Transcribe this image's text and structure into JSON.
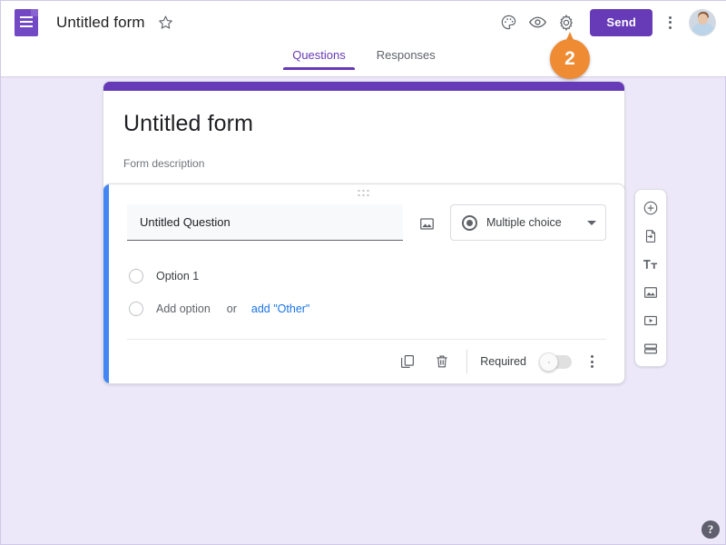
{
  "app": {
    "name": "Google Forms",
    "background_color": "#ece8fa",
    "accent_color": "#673ab7",
    "selected_color": "#4285f4",
    "link_color": "#1a73e8",
    "callout_color": "#ee8b33"
  },
  "topbar": {
    "forms_icon": "forms-document-icon",
    "doc_title": "Untitled form",
    "star_icon": "star-outline-icon",
    "theme_icon": "palette-icon",
    "preview_icon": "eye-icon",
    "settings_icon": "gear-icon",
    "send_label": "Send",
    "more_icon": "kebab-menu-icon",
    "avatar": "user-avatar"
  },
  "callout": {
    "number": "2",
    "target": "settings-gear-button"
  },
  "tabs": [
    {
      "label": "Questions",
      "active": true
    },
    {
      "label": "Responses",
      "active": false
    }
  ],
  "form_header": {
    "title": "Untitled form",
    "description": "Form description"
  },
  "question": {
    "drag_handle": "drag-handle-dots",
    "title": "Untitled Question",
    "image_icon": "add-image-icon",
    "type": {
      "label": "Multiple choice",
      "icon": "radio-filled-icon",
      "caret": "chevron-down-icon"
    },
    "options": [
      {
        "label": "Option 1",
        "kind": "option"
      }
    ],
    "add_option": {
      "label": "Add option",
      "or": "or",
      "other_link": "add \"Other\""
    },
    "footer": {
      "duplicate_icon": "duplicate-icon",
      "delete_icon": "trash-icon",
      "required_label": "Required",
      "required_on": false,
      "more_icon": "kebab-menu-icon"
    }
  },
  "side_toolbar": [
    {
      "name": "add-question-button",
      "icon": "plus-circle-icon"
    },
    {
      "name": "import-questions-button",
      "icon": "import-file-icon"
    },
    {
      "name": "add-title-description-button",
      "icon": "text-format-icon"
    },
    {
      "name": "add-image-button",
      "icon": "image-icon"
    },
    {
      "name": "add-video-button",
      "icon": "video-icon"
    },
    {
      "name": "add-section-button",
      "icon": "section-icon"
    }
  ],
  "help": {
    "label": "?"
  }
}
